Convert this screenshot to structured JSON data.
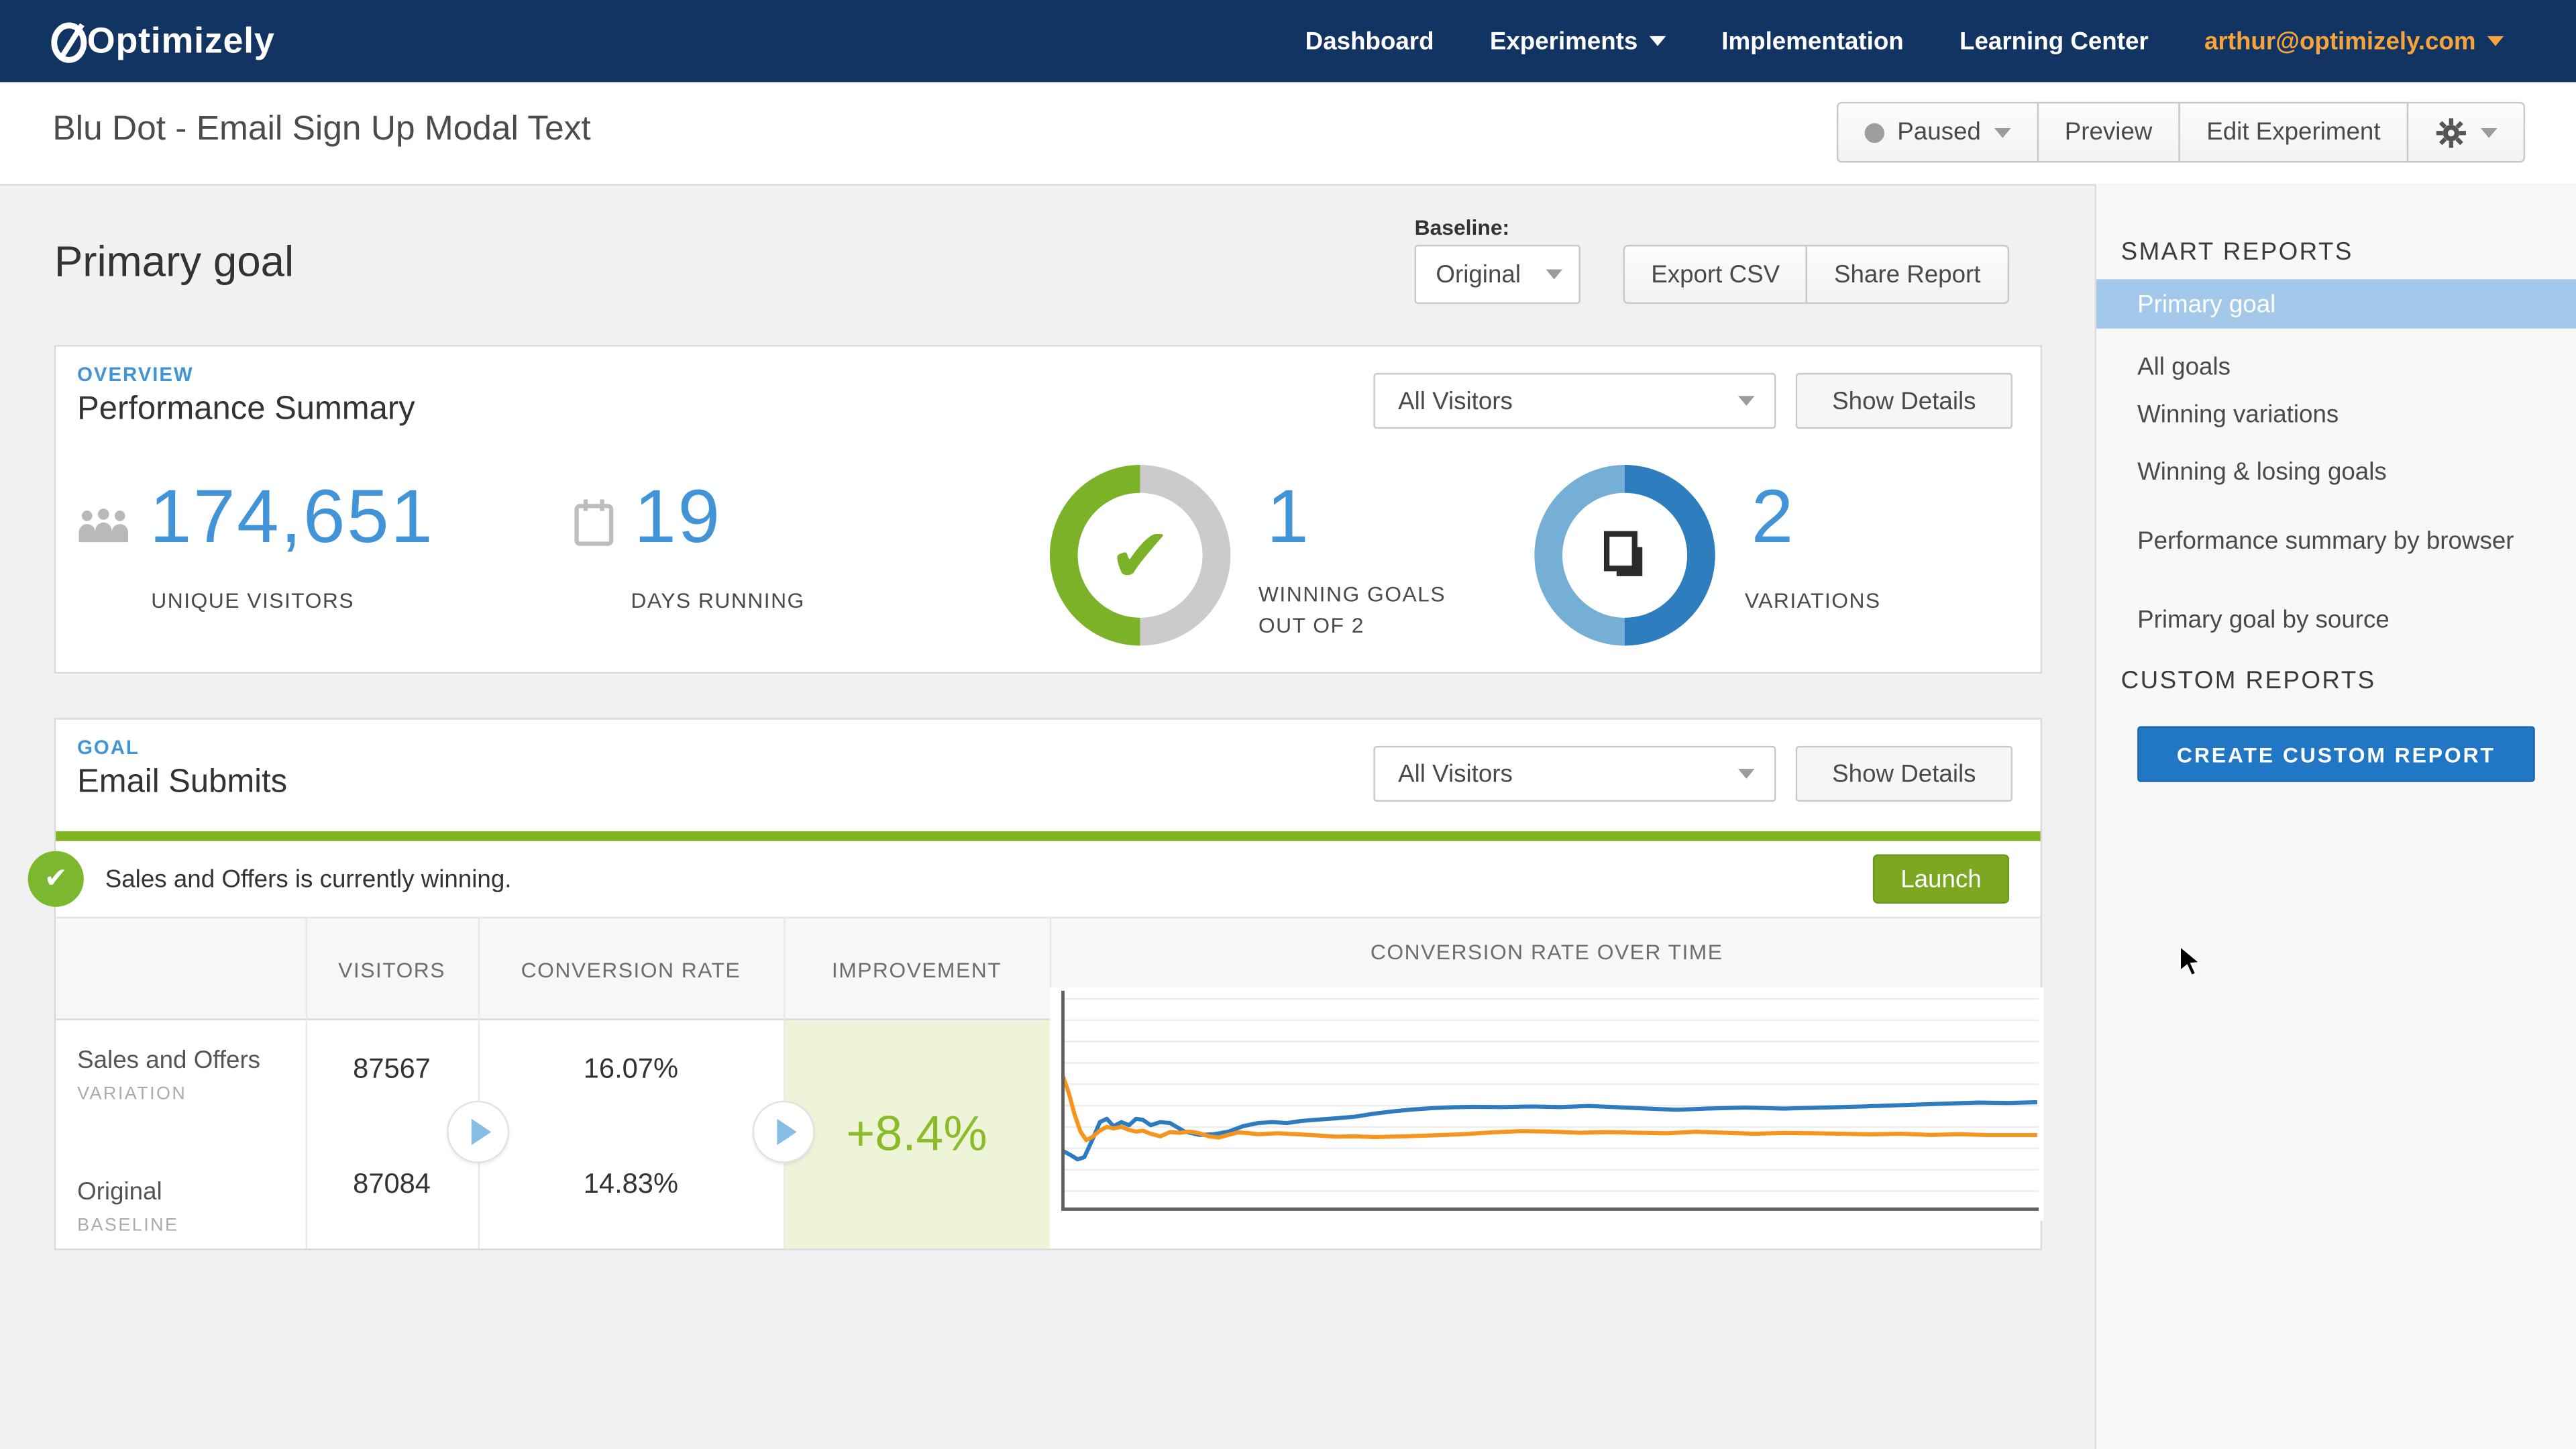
{
  "nav": {
    "brand": "Optimizely",
    "items": [
      {
        "label": "Dashboard"
      },
      {
        "label": "Experiments",
        "has_dropdown": true
      },
      {
        "label": "Implementation"
      },
      {
        "label": "Learning Center"
      }
    ],
    "account": "arthur@optimizely.com"
  },
  "title_bar": {
    "title": "Blu Dot - Email Sign Up Modal Text",
    "status_label": "Paused",
    "preview_label": "Preview",
    "edit_label": "Edit Experiment"
  },
  "report_header": {
    "title": "Primary goal",
    "baseline_label": "Baseline:",
    "baseline_value": "Original",
    "export_csv": "Export CSV",
    "share_report": "Share Report"
  },
  "overview": {
    "eyebrow": "OVERVIEW",
    "title": "Performance Summary",
    "audience": "All Visitors",
    "show_details": "Show Details",
    "stats": {
      "visitors": {
        "value": "174,651",
        "label": "UNIQUE VISITORS"
      },
      "days": {
        "value": "19",
        "label": "DAYS RUNNING"
      },
      "winning": {
        "value": "1",
        "label_line1": "WINNING GOALS",
        "label_line2": "OUT OF 2"
      },
      "variations": {
        "value": "2",
        "label": "VARIATIONS"
      }
    }
  },
  "goal": {
    "eyebrow": "GOAL",
    "title": "Email Submits",
    "audience": "All Visitors",
    "show_details": "Show Details",
    "banner_message": "Sales and Offers is currently winning.",
    "launch_label": "Launch",
    "columns": {
      "visitors": "VISITORS",
      "conversion_rate": "CONVERSION RATE",
      "improvement": "IMPROVEMENT",
      "chart": "CONVERSION RATE OVER TIME"
    },
    "rows": [
      {
        "name": "Sales and Offers",
        "tag": "VARIATION",
        "visitors": "87567",
        "conversion_rate": "16.07%"
      },
      {
        "name": "Original",
        "tag": "BASELINE",
        "visitors": "87084",
        "conversion_rate": "14.83%"
      }
    ],
    "improvement_value": "+8.4%"
  },
  "chart_data": {
    "type": "line",
    "title": "CONVERSION RATE OVER TIME",
    "xlabel": "time (19 days running, axis unlabeled)",
    "ylabel": "conversion rate % (axis unlabeled)",
    "ylim": [
      0,
      40
    ],
    "grid": true,
    "legend": false,
    "series": [
      {
        "name": "Sales and Offers (variation)",
        "color": "#2E7CC0",
        "final_value_pct": 16.07,
        "approx_values_pct": [
          9.5,
          13.8,
          14.2,
          13.9,
          14.3,
          14.0,
          14.4,
          14.6,
          14.9,
          15.1,
          15.3,
          15.5,
          15.6,
          15.6,
          15.7,
          15.8,
          15.9,
          16.0,
          16.07
        ]
      },
      {
        "name": "Original (baseline)",
        "color": "#F7941E",
        "final_value_pct": 14.83,
        "approx_values_pct": [
          22.0,
          15.5,
          15.0,
          14.7,
          14.5,
          14.4,
          14.3,
          14.2,
          14.1,
          14.2,
          14.3,
          14.5,
          14.6,
          14.6,
          14.7,
          14.7,
          14.75,
          14.8,
          14.83
        ]
      }
    ],
    "render": {
      "gridline_count": 10,
      "series": [
        {
          "color": "#2E7CC0",
          "points": [
            [
              0.0,
              0.75
            ],
            [
              0.008,
              0.77
            ],
            [
              0.015,
              0.79
            ],
            [
              0.022,
              0.78
            ],
            [
              0.03,
              0.7
            ],
            [
              0.038,
              0.615
            ],
            [
              0.045,
              0.6
            ],
            [
              0.052,
              0.635
            ],
            [
              0.06,
              0.615
            ],
            [
              0.068,
              0.63
            ],
            [
              0.075,
              0.6
            ],
            [
              0.082,
              0.605
            ],
            [
              0.09,
              0.63
            ],
            [
              0.1,
              0.615
            ],
            [
              0.11,
              0.62
            ],
            [
              0.125,
              0.66
            ],
            [
              0.14,
              0.675
            ],
            [
              0.155,
              0.672
            ],
            [
              0.17,
              0.66
            ],
            [
              0.185,
              0.635
            ],
            [
              0.2,
              0.62
            ],
            [
              0.215,
              0.615
            ],
            [
              0.23,
              0.62
            ],
            [
              0.245,
              0.61
            ],
            [
              0.26,
              0.605
            ],
            [
              0.28,
              0.598
            ],
            [
              0.3,
              0.59
            ],
            [
              0.32,
              0.575
            ],
            [
              0.34,
              0.565
            ],
            [
              0.36,
              0.556
            ],
            [
              0.38,
              0.55
            ],
            [
              0.4,
              0.546
            ],
            [
              0.42,
              0.544
            ],
            [
              0.45,
              0.545
            ],
            [
              0.48,
              0.542
            ],
            [
              0.51,
              0.545
            ],
            [
              0.54,
              0.54
            ],
            [
              0.57,
              0.546
            ],
            [
              0.6,
              0.552
            ],
            [
              0.63,
              0.558
            ],
            [
              0.66,
              0.552
            ],
            [
              0.7,
              0.548
            ],
            [
              0.74,
              0.552
            ],
            [
              0.78,
              0.548
            ],
            [
              0.82,
              0.542
            ],
            [
              0.86,
              0.536
            ],
            [
              0.9,
              0.53
            ],
            [
              0.94,
              0.524
            ],
            [
              0.97,
              0.526
            ],
            [
              1.0,
              0.522
            ]
          ]
        },
        {
          "color": "#F7941E",
          "points": [
            [
              0.0,
              0.4
            ],
            [
              0.006,
              0.48
            ],
            [
              0.012,
              0.58
            ],
            [
              0.018,
              0.66
            ],
            [
              0.024,
              0.7
            ],
            [
              0.03,
              0.685
            ],
            [
              0.038,
              0.655
            ],
            [
              0.045,
              0.638
            ],
            [
              0.052,
              0.645
            ],
            [
              0.06,
              0.638
            ],
            [
              0.068,
              0.652
            ],
            [
              0.075,
              0.66
            ],
            [
              0.082,
              0.655
            ],
            [
              0.09,
              0.67
            ],
            [
              0.1,
              0.682
            ],
            [
              0.11,
              0.662
            ],
            [
              0.12,
              0.665
            ],
            [
              0.13,
              0.66
            ],
            [
              0.14,
              0.668
            ],
            [
              0.15,
              0.682
            ],
            [
              0.16,
              0.688
            ],
            [
              0.17,
              0.675
            ],
            [
              0.18,
              0.664
            ],
            [
              0.19,
              0.667
            ],
            [
              0.2,
              0.672
            ],
            [
              0.22,
              0.668
            ],
            [
              0.24,
              0.672
            ],
            [
              0.26,
              0.678
            ],
            [
              0.28,
              0.684
            ],
            [
              0.3,
              0.682
            ],
            [
              0.32,
              0.685
            ],
            [
              0.35,
              0.682
            ],
            [
              0.38,
              0.678
            ],
            [
              0.41,
              0.672
            ],
            [
              0.44,
              0.664
            ],
            [
              0.47,
              0.658
            ],
            [
              0.5,
              0.66
            ],
            [
              0.53,
              0.665
            ],
            [
              0.56,
              0.662
            ],
            [
              0.59,
              0.665
            ],
            [
              0.62,
              0.668
            ],
            [
              0.65,
              0.661
            ],
            [
              0.68,
              0.665
            ],
            [
              0.71,
              0.67
            ],
            [
              0.74,
              0.666
            ],
            [
              0.77,
              0.668
            ],
            [
              0.8,
              0.67
            ],
            [
              0.83,
              0.673
            ],
            [
              0.86,
              0.67
            ],
            [
              0.89,
              0.675
            ],
            [
              0.92,
              0.672
            ],
            [
              0.95,
              0.676
            ],
            [
              1.0,
              0.676
            ]
          ]
        }
      ]
    }
  },
  "sidebar": {
    "smart_reports_header": "SMART REPORTS",
    "items": [
      {
        "label": "Primary goal",
        "selected": true
      },
      {
        "label": "All goals"
      },
      {
        "label": "Winning variations"
      },
      {
        "label": "Winning & losing goals"
      },
      {
        "label": "Performance summary by browser"
      },
      {
        "label": "Primary goal by source"
      }
    ],
    "custom_reports_header": "CUSTOM REPORTS",
    "create_button": "CREATE CUSTOM REPORT"
  },
  "colors": {
    "nav_bg": "#123462",
    "accent_blue": "#4294D8",
    "account_orange": "#F6A43C",
    "green": "#7CB228",
    "green_bar": "#7EB41F",
    "launch_green": "#7CA821",
    "donut_gray": "#CBCBCB",
    "donut_dark_blue": "#2E7DBE",
    "donut_light_blue": "#75AFD6",
    "selected_item_bg": "#A4C8E9",
    "create_button_bg": "#2277C4",
    "improvement_bg": "#EDF4D8",
    "improvement_text": "#8CBB2A",
    "line_blue": "#2E7CC0",
    "line_orange": "#F7941E"
  }
}
